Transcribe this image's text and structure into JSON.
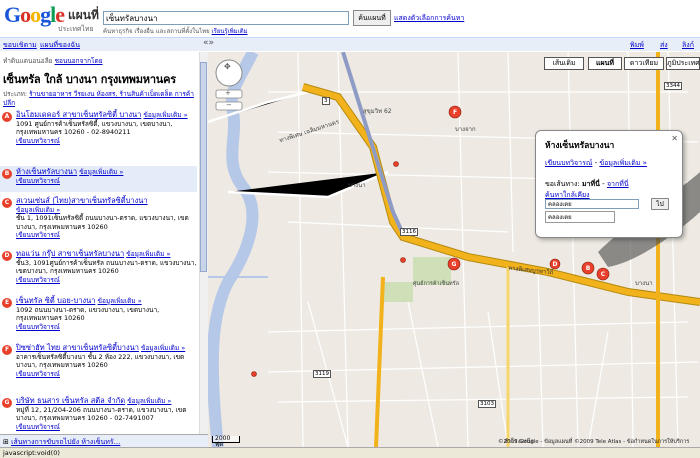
{
  "header": {
    "logo_text": "Google",
    "maps_label": "แผนที่",
    "country_label": "ประเทศไทย",
    "search_value": "เซ็นทรัลบางนา",
    "search_button": "ค้นแผนที่",
    "search_options": "แสดงตัวเลือกการค้นหา",
    "search_example_prefix": "ค้นหาธุรกิจ เรื่องอื่น และสถานที่ตั้งในไทย",
    "search_example_link": "เรียนรู้เพิ่มเติม"
  },
  "subbar": {
    "results_link": "ขอบเขิตาม",
    "my_maps_link": "แผนที่ของฉัน",
    "collapse_icon": "«»",
    "print_link": "พิมพ์",
    "send_link": "ส่ง",
    "link_link": "ลิงก์"
  },
  "left_panel": {
    "view_as": "ทำดินแดนอนอลีย",
    "view_as_link": "ชอนนอกจากโดย",
    "results_title": "เซ็นทรัล ใกล้ บางนา กรุงเทพมหานคร",
    "categories_label": "ประเภท:",
    "categories_links": "ร้านขายอาหาร วีรยเงน ห้องสร, ร้านสินค้าเบ็ดเตล็ด การค้าปลีก",
    "results": [
      {
        "letter": "A",
        "name": "อินโฮมเดคอร์ สาขาเซ็นทรัลซิตี้ บางนา",
        "more": "ข้อมูลเพิ่มเติม »",
        "address": "1091 ศูนย์การค้าเซ็นทรัลซิตี้, แขวงบางนา, เขตบางนา, กรุงเทพมหานคร 10260 - 02-8940211",
        "reviews": "เขียนบทวิจารณ์"
      },
      {
        "letter": "B",
        "name": "ห้างเซ็นทรัลบางนา",
        "more": "ข้อมูลเพิ่มเติม »",
        "address": "",
        "reviews": "เขียนบทวิจารณ์"
      },
      {
        "letter": "C",
        "name": "สเวนเซ่นส์ (ไทย)สาขาเซ็นทรัลซิตี้บางนา",
        "more": "ข้อมูลเพิ่มเติม »",
        "address": "ชั้น 1, 1091เซ็นทรัลซิตี้ ถนนบางนา-ตราด, แขวงบางนา, เขตบางนา, กรุงเทพมหานคร 10260",
        "reviews": "เขียนบทวิจารณ์"
      },
      {
        "letter": "D",
        "name": "ทอแว่น กรุ๊ป สาขาเซ็นทรัลบางนา",
        "more": "ข้อมูลเพิ่มเติม »",
        "address": "ชั้น3, 1091ศูนย์การค้าเซ็นทรัล ถนนบางนา-ตราด, แขวงบางนา, เขตบางนา, กรุงเทพมหานคร 10260",
        "reviews": "เขียนบทวิจารณ์"
      },
      {
        "letter": "E",
        "name": "เซ็นทรัล ซิตี้ บอย-บางนา",
        "more": "ข้อมูลเพิ่มเติม »",
        "address": "1092 ถนนบางนา-ตราด, แขวงบางนา, เขตบางนา, กรุงเทพมหานคร 10260",
        "reviews": "เขียนบทวิจารณ์"
      },
      {
        "letter": "F",
        "name": "ปิซซ่าฮัท ไทย สาขาเซ็นทรัลซิตี้บางนา",
        "more": "ข้อมูลเพิ่มเติม »",
        "address": "อาคารเซ็นทรัลซิตี้บางนา ชั้น 2 ห้อง 222, แขวงบางนา, เขตบางนา, กรุงเทพมหานคร 10260",
        "reviews": "เขียนบทวิจารณ์"
      },
      {
        "letter": "G",
        "name": "บริษัท ธนสาร เซ็นทรัล สตีล จำกัด",
        "more": "ข้อมูลเพิ่มเติม »",
        "address": "หมู่ที่ 12, 21/204-206 ถนนบางนา-ตราด, แขวงบางนา, เขตบางนา, กรุงเทพมหานคร 10260 - 02-7491007",
        "reviews": "เขียนบทวิจารณ์"
      }
    ],
    "bottom_bar": "เส้นทางการขับรถไปยัง ห้างเซ็นทรั..."
  },
  "map": {
    "types": [
      "เส้นเดิม",
      "แผนที่",
      "ดาวเทียม",
      "ภูมิประเทศ"
    ],
    "active_type": "แผนที่",
    "infowindow": {
      "title": "ห้างเซ็นทรัลบางนา",
      "reviews_link": "เขียนบทวิจารณ์",
      "more_link": "ข้อมูลเพิ่มเติม »",
      "directions_label": "ขอเส้นทาง:",
      "to_here": "มาที่นี่",
      "from_here": "จากที่นี่",
      "search_nearby": "ค้นหาใกล้เคียง",
      "input_value": "คลองเตย",
      "autocomplete": "คลองเตย",
      "go_button": "ไป"
    },
    "road_labels": [
      "ทางพิเศษ เฉลิมมหานคร",
      "สุขุมวิท 62",
      "บางจาก",
      "บางนา",
      "ทางพิเศษบูรพาวิถี",
      "ศูนย์การค้าเซ็นทรัล",
      "สำโรงเหนือ",
      "บางนา"
    ],
    "route_shields": [
      "3",
      "3116",
      "3119",
      "3344",
      "3103"
    ],
    "scale": "2000 ฟุต",
    "copyright": "©2009 Google - ข้อมูลแผนที่ ©2009 Tele Atlas - ข้อกำหนดในการให้บริการ"
  },
  "status_bar": "javascript:void(0)",
  "colors": {
    "link": "#0000cc",
    "marker": "#e8402b",
    "highway": "#f2b21c",
    "road": "#ffffff",
    "water": "#b6c8e8"
  }
}
